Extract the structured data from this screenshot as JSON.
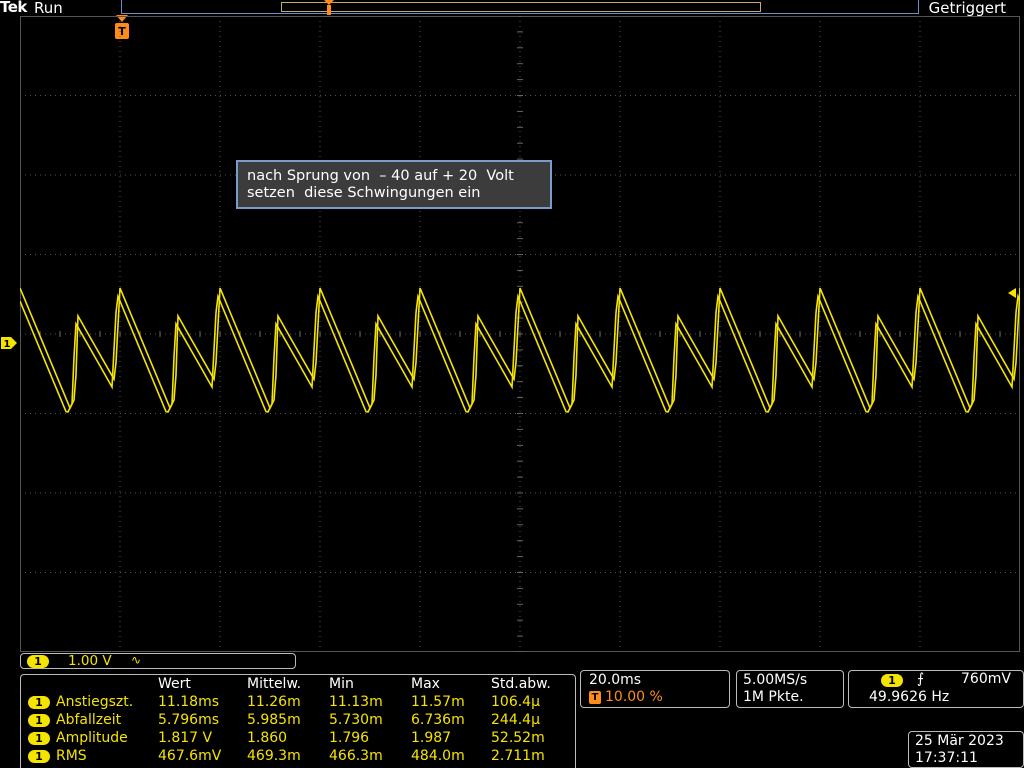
{
  "top_bar": {
    "brand": "Tek",
    "run_state": "Run",
    "trigger_state": "Getriggert"
  },
  "annotation": {
    "line1": "nach Sprung von  – 40 auf + 20  Volt",
    "line2": "setzen  diese Schwingungen ein"
  },
  "channel": {
    "number": "1",
    "scale": "1.00 V",
    "coupling_symbol": "∿",
    "trace_color": "#f5e400"
  },
  "trigger_marker_label": "T",
  "measurements": {
    "headers": [
      "Wert",
      "Mittelw.",
      "Min",
      "Max",
      "Std.abw."
    ],
    "rows": [
      {
        "channel": "1",
        "name": "Anstiegszt.",
        "values": [
          "11.18ms",
          "11.26m",
          "11.13m",
          "11.57m",
          "106.4μ"
        ]
      },
      {
        "channel": "1",
        "name": "Abfallzeit",
        "values": [
          "5.796ms",
          "5.985m",
          "5.730m",
          "6.736m",
          "244.4μ"
        ]
      },
      {
        "channel": "1",
        "name": "Amplitude",
        "values": [
          "1.817 V",
          "1.860",
          "1.796",
          "1.987",
          "52.52m"
        ]
      },
      {
        "channel": "1",
        "name": "RMS",
        "values": [
          "467.6mV",
          "469.3m",
          "466.3m",
          "484.0m",
          "2.711m"
        ]
      }
    ]
  },
  "horizontal": {
    "timebase": "20.0ms",
    "trigger_position": "10.00 %"
  },
  "acquisition": {
    "sample_rate": "5.00MS/s",
    "record_length": "1M Pkte."
  },
  "trigger": {
    "channel": "1",
    "edge_symbol": "⨍",
    "level": "760mV",
    "frequency": "49.9626 Hz"
  },
  "datetime": {
    "date": "25 Mär 2023",
    "time": "17:37:11"
  }
}
